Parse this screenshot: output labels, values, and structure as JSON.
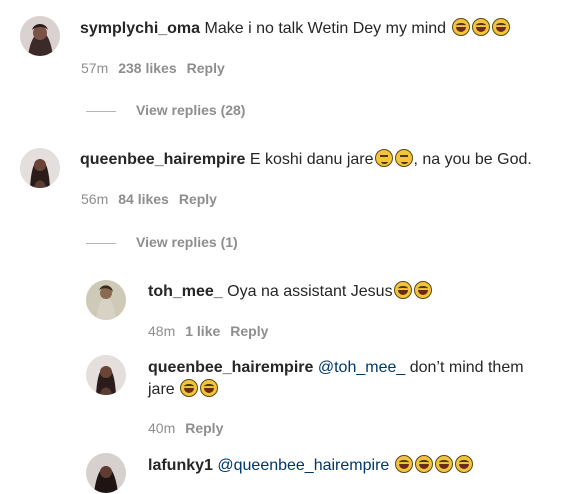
{
  "comments": [
    {
      "username": "symplychi_oma",
      "text": "Make i no talk Wetin Dey my mind",
      "emojis": [
        "laughing-tears",
        "laughing-tears",
        "laughing-tears"
      ],
      "time": "57m",
      "likes": "238 likes",
      "reply": "Reply",
      "view_replies": "View replies (28)"
    },
    {
      "username": "queenbee_hairempire",
      "text_before": "E koshi danu jare",
      "text_after": ", na you be God.",
      "emojis": [
        "smirk",
        "smirk"
      ],
      "time": "56m",
      "likes": "84 likes",
      "reply": "Reply",
      "view_replies": "View replies (1)"
    }
  ],
  "replies": [
    {
      "username": "toh_mee_",
      "text": "Oya na assistant Jesus",
      "emojis": [
        "laughing-tears",
        "laughing-tears"
      ],
      "time": "48m",
      "likes": "1 like",
      "reply": "Reply"
    },
    {
      "username": "queenbee_hairempire",
      "mention": "@toh_mee_",
      "text_line1": "don’t mind them",
      "text_line2": "jare",
      "emojis": [
        "laughing-tears",
        "laughing-tears"
      ],
      "time": "40m",
      "reply": "Reply"
    },
    {
      "username": "lafunky1",
      "mention": "@queenbee_hairempire",
      "emojis": [
        "laughing-tears",
        "laughing-tears",
        "laughing-tears",
        "laughing-tears"
      ]
    }
  ],
  "colors": {
    "text": "#262626",
    "secondary": "#8e8e8e",
    "mention": "#00376b"
  }
}
